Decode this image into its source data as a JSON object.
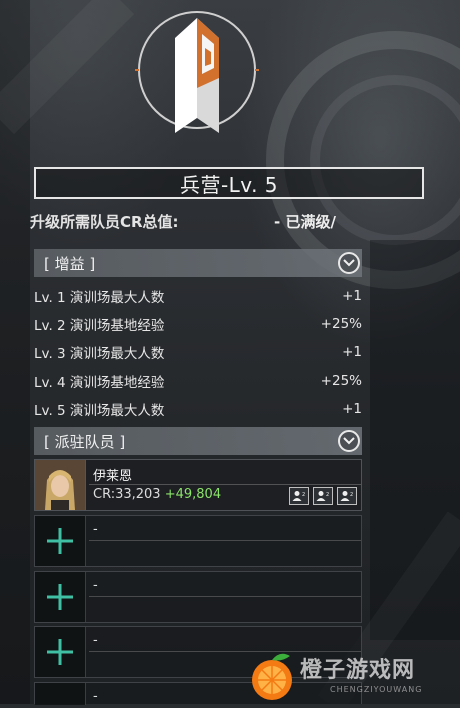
{
  "building": {
    "title": "兵营-Lv. 5",
    "requirement_label": "升级所需队员CR总值:",
    "requirement_value": "- 已满级/"
  },
  "buffs": {
    "header": "[ 增益 ]",
    "rows": [
      {
        "label": "Lv. 1 演训场最大人数",
        "value": "+1"
      },
      {
        "label": "Lv. 2 演训场基地经验",
        "value": "+25%"
      },
      {
        "label": "Lv. 3 演训场最大人数",
        "value": "+1"
      },
      {
        "label": "Lv. 4 演训场基地经验",
        "value": "+25%"
      },
      {
        "label": "Lv. 5 演训场最大人数",
        "value": "+1"
      }
    ]
  },
  "members": {
    "header": "[ 派驻队员 ]",
    "assigned": {
      "name": "伊莱恩",
      "cr": "CR:33,203",
      "cr_bonus": "+49,804",
      "role_icons": [
        "person-role-icon",
        "person-role-icon",
        "person-role-icon"
      ]
    },
    "empty_slots": [
      {
        "text": "-"
      },
      {
        "text": "-"
      },
      {
        "text": "-"
      },
      {
        "text": "-"
      }
    ]
  },
  "colors": {
    "accent_orange": "#d2702e",
    "bonus_green": "#8be36a",
    "slot_plus_teal": "#3fbfa3"
  },
  "watermark": {
    "text": "橙子游戏网",
    "sub": "CHENGZIYOUWANG"
  }
}
